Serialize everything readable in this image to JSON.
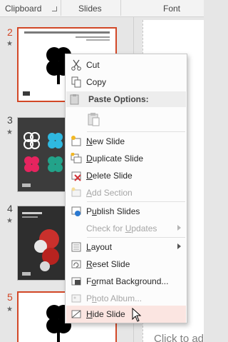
{
  "ribbon": {
    "groups": [
      "Clipboard",
      "Slides",
      "Font"
    ]
  },
  "slides": [
    {
      "num": "2",
      "selected": true
    },
    {
      "num": "3",
      "selected": false
    },
    {
      "num": "4",
      "selected": false
    },
    {
      "num": "5",
      "selected": true
    }
  ],
  "star": "★",
  "editor": {
    "placeholder": "Click to ad"
  },
  "menu": {
    "cut": "Cut",
    "copy": "Copy",
    "paste_options": "Paste Options:",
    "new_slide": "New Slide",
    "duplicate_slide": "Duplicate Slide",
    "delete_slide": "Delete Slide",
    "add_section": "Add Section",
    "publish_slides": "Publish Slides",
    "check_updates": "Check for Updates",
    "layout": "Layout",
    "reset_slide": "Reset Slide",
    "format_background": "Format Background...",
    "photo_album": "Photo Album...",
    "hide_slide": "Hide Slide"
  },
  "colors": {
    "accent": "#d24726",
    "hover": "#fbe5e1"
  }
}
